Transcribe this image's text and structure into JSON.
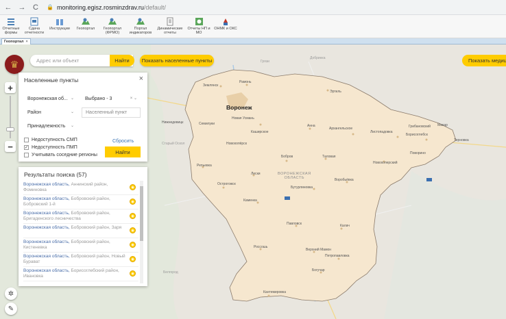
{
  "browser": {
    "back": "←",
    "forward": "→",
    "reload": "C",
    "url_host": "monitoring.egisz.rosminzdrav.ru",
    "url_path": "/default/"
  },
  "toolbar": {
    "items": [
      {
        "label": "Отчетные формы",
        "icon": "grid-icon"
      },
      {
        "label": "Сдача отчетности",
        "icon": "report-icon"
      },
      {
        "label": "Инструкции",
        "icon": "book-icon"
      },
      {
        "label": "Геопортал",
        "icon": "map-icon"
      },
      {
        "label": "Геопортал (ФРМО)",
        "icon": "map-icon"
      },
      {
        "label": "Портал индикаторов",
        "icon": "map-icon"
      },
      {
        "label": "Динамические отчеты",
        "icon": "document-icon"
      },
      {
        "label": "Отчеты НП и МО",
        "icon": "chart-icon"
      },
      {
        "label": "ОНМК и ОКС",
        "icon": "medical-icon"
      }
    ]
  },
  "tab": {
    "label": "Геопортал",
    "close": "×"
  },
  "map_controls": {
    "search_placeholder": "Адрес или объект",
    "find": "Найти",
    "show_settlements": "Показать населенные пункты",
    "show_medical": "Показать медиц",
    "zoom_in": "+",
    "zoom_out": "−"
  },
  "settlements_panel": {
    "title": "Населенные пункты",
    "close": "×",
    "region_select": "Воронежская об...",
    "selected_count": "Выбрано - 3",
    "district_select": "Район",
    "settlement_input_placeholder": "Населенный пункт",
    "affiliation_select": "Принадлежность",
    "checkboxes": [
      {
        "label": "Недоступность СМП",
        "checked": false
      },
      {
        "label": "Недоступность ПМП",
        "checked": true
      },
      {
        "label": "Учитывать соседние регионы",
        "checked": false
      }
    ],
    "reset": "Сбросить",
    "find": "Найти"
  },
  "results": {
    "title": "Результаты поиска (57)",
    "items": [
      {
        "main": "Воронежская область,",
        "rest": "Аннинский район, Фоминовка"
      },
      {
        "main": "Воронежская область,",
        "rest": "Бобровский район, Бобровский 1-й"
      },
      {
        "main": "Воронежская область,",
        "rest": "Бобровский район, Бригаденского лесничества"
      },
      {
        "main": "Воронежская область,",
        "rest": "Бобровский район, Заря"
      },
      {
        "main": "Воронежская область,",
        "rest": "Бобровский район, Кистеневка"
      },
      {
        "main": "Воронежская область,",
        "rest": "Бобровский район, Новый Бурават"
      },
      {
        "main": "Воронежская область,",
        "rest": "Борисоглебский район, Ивановка"
      }
    ]
  },
  "map_labels": {
    "voronezh": "Воронеж",
    "region_line1": "ВОРОНЕЖСКАЯ",
    "region_line2": "ОБЛАСТЬ",
    "towns": [
      "Землянск",
      "Рамонь",
      "Эртиль",
      "Новая Усмань",
      "Семилуки",
      "Каширское",
      "Анна",
      "Архангельское",
      "Листопадовка",
      "Грибановский",
      "Борисоглебск",
      "Макар",
      "Терновка",
      "Поворино",
      "Нижнедевицк",
      "Новохопёрск",
      "Бобров",
      "Таловая",
      "Новохоперский",
      "Репьевка",
      "Лиски",
      "Острогожск",
      "Бутурлиновка",
      "Воробьёвка",
      "Каменка",
      "Павловск",
      "Калач",
      "Россошь",
      "Верхний Мамон",
      "Петропавловка",
      "Богучар",
      "Кантемировка"
    ],
    "outside": [
      "Добринка",
      "Грязи",
      "Старый Оскол",
      "Белгород"
    ]
  },
  "colors": {
    "accent": "#ffcc00",
    "region_fill": "#f6e7cf",
    "region_border": "#8a7a6a",
    "map_bg": "#e8e6e1",
    "link": "#4a6ea9"
  }
}
